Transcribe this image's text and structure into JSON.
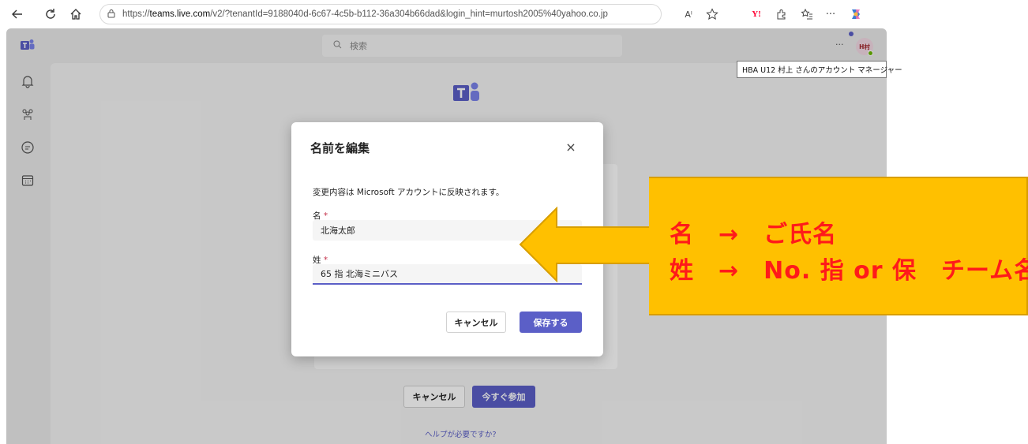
{
  "browser": {
    "url_prefix": "https://",
    "url_host": "teams.live.com",
    "url_rest": "/v2/?tenantId=9188040d-6c67-4c5b-b112-36a304b66dad&login_hint=murtosh2005%40yahoo.co.jp",
    "read_aloud": "Aˡ",
    "more": "···"
  },
  "teams": {
    "search_placeholder": "検索",
    "more": "···",
    "avatar_initials": "H村",
    "tooltip": "HBA U12 村上 さんのアカウント マネージャー",
    "background_cancel": "キャンセル",
    "background_join": "今すぐ参加",
    "help_link": "ヘルプが必要ですか?"
  },
  "dialog": {
    "title": "名前を編集",
    "close": "×",
    "description": "変更内容は Microsoft アカウントに反映されます。",
    "first_name_label": "名",
    "first_name_value": "北海太郎",
    "last_name_label": "姓",
    "last_name_value": "65 指 北海ミニバス",
    "required_mark": "*",
    "cancel_label": "キャンセル",
    "save_label": "保存する"
  },
  "callout": {
    "line1": "名　→　ご氏名",
    "line2": "姓　→　No. 指 or 保　チーム名"
  },
  "colors": {
    "accent": "#5b5fc7",
    "callout_fill": "#ffc000",
    "callout_text": "#ff1a1a",
    "required": "#c4314b"
  }
}
